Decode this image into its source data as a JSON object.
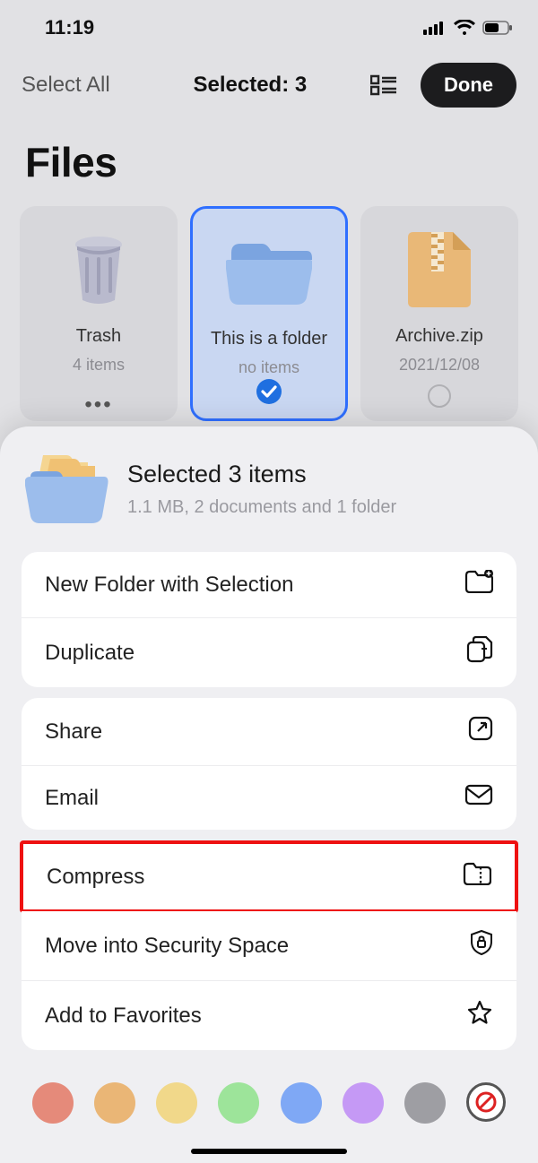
{
  "status": {
    "time": "11:19"
  },
  "toolbar": {
    "select_all": "Select All",
    "selected_label": "Selected: 3",
    "done": "Done"
  },
  "page_title": "Files",
  "grid": [
    {
      "name": "Trash",
      "meta": "4 items",
      "icon": "trash",
      "selected": false,
      "has_ellipsis": true
    },
    {
      "name": "This is a folder",
      "meta": "no items",
      "icon": "folder",
      "selected": true,
      "has_check": true
    },
    {
      "name": "Archive.zip",
      "meta": "2021/12/08",
      "icon": "zip",
      "selected": false,
      "has_empty_circle": true
    }
  ],
  "sheet": {
    "title": "Selected 3 items",
    "subtitle": "1.1 MB, 2 documents and 1 folder",
    "groups": [
      [
        {
          "label": "New Folder with Selection",
          "icon": "folder-plus"
        },
        {
          "label": "Duplicate",
          "icon": "duplicate"
        }
      ],
      [
        {
          "label": "Share",
          "icon": "share"
        },
        {
          "label": "Email",
          "icon": "mail"
        }
      ],
      [
        {
          "label": "Compress",
          "icon": "zip"
        }
      ],
      [
        {
          "label": "Move into Security Space",
          "icon": "shield-lock"
        },
        {
          "label": "Add to Favorites",
          "icon": "star"
        }
      ]
    ],
    "colors": [
      "#e58a7a",
      "#eab676",
      "#f1d88a",
      "#9de49a",
      "#7fa8f5",
      "#c599f5",
      "#9e9ea3"
    ]
  }
}
